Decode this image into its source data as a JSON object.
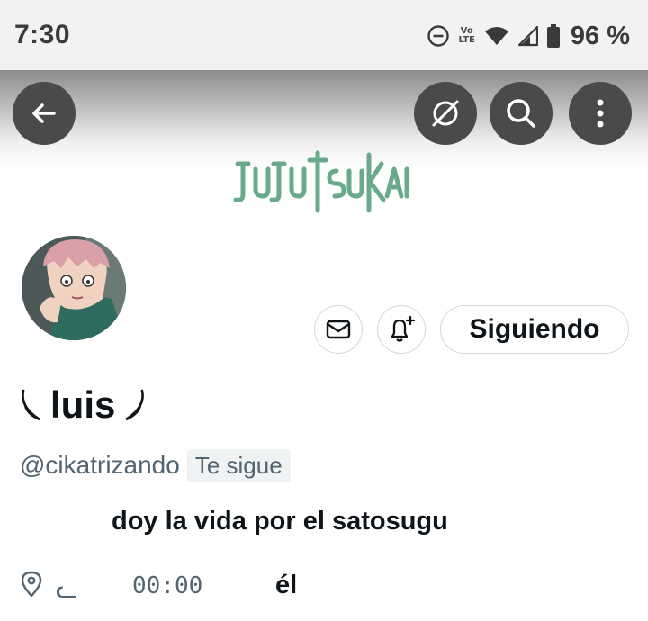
{
  "status_bar": {
    "time": "7:30",
    "battery": "96 %",
    "volte_top": "Vo",
    "volte_bottom": "LTE",
    "icons": [
      "do-not-disturb-icon",
      "volte-icon",
      "wifi-icon",
      "signal-icon",
      "battery-icon"
    ]
  },
  "header": {
    "back_icon": "arrow-left-icon",
    "actions": [
      "no-notifications-icon",
      "search-icon",
      "more-vertical-icon"
    ],
    "banner_text": "JUJUTSU KAISEN",
    "banner_color": "#6aaa8c"
  },
  "profile": {
    "display_name": "luis",
    "handle": "@cikatrizando",
    "follows_you": "Te sigue",
    "bio": "doy la vida por el satosugu",
    "location_glyph": "ᓚ",
    "time_text": "00:00",
    "extra_word": "él"
  },
  "actions": {
    "message_icon": "mail-icon",
    "notify_icon": "bell-plus-icon",
    "following_label": "Siguiendo"
  },
  "colors": {
    "text": "#0f1419",
    "secondary": "#536471",
    "border": "#cfd9de",
    "header_button": "#4a4a4a"
  }
}
